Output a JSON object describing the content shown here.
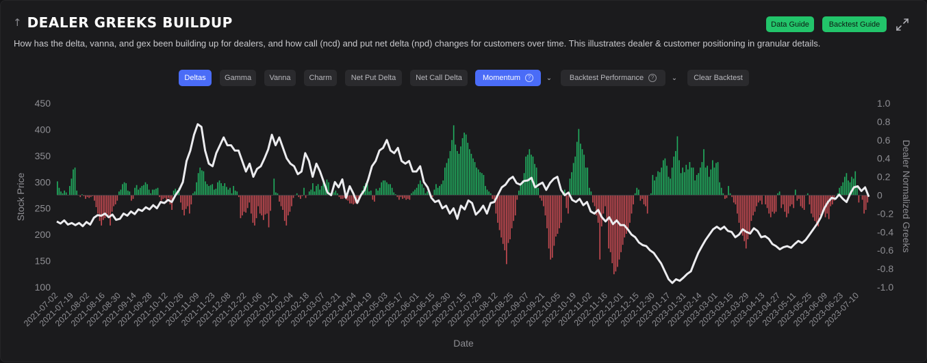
{
  "header": {
    "title": "DEALER GREEKS BUILDUP",
    "subtitle": "How has the delta, vanna, and gex been building up for dealers, and how call (ncd) and put net delta (npd) changes for customers over time. This illustrates dealer & customer positioning in granular details.",
    "collapse_icon": "arrow-up-icon",
    "expand_icon": "expand-icon",
    "buttons": {
      "data_guide": "Data Guide",
      "backtest_guide": "Backtest Guide"
    }
  },
  "toolbar": {
    "tabs": [
      {
        "label": "Deltas",
        "active": true
      },
      {
        "label": "Gamma",
        "active": false
      },
      {
        "label": "Vanna",
        "active": false
      },
      {
        "label": "Charm",
        "active": false
      },
      {
        "label": "Net Put Delta",
        "active": false
      },
      {
        "label": "Net Call Delta",
        "active": false
      }
    ],
    "momentum": {
      "label": "Momentum",
      "active": true
    },
    "backtest_performance": {
      "label": "Backtest Performance"
    },
    "clear_backtest": {
      "label": "Clear Backtest"
    }
  },
  "colors": {
    "positive": "#22c46a",
    "negative": "#e0525a",
    "price_line": "#ececef",
    "accent": "#4a6cf7",
    "axis_text": "#8e8e93"
  },
  "chart_data": {
    "type": "bar",
    "title": "",
    "xlabel": "Date",
    "ylabel": "Stock Price",
    "y2label": "Dealer Normalized Greeks",
    "ylim": [
      100,
      450
    ],
    "y2lim": [
      -1.0,
      1.0
    ],
    "yticks": [
      "450",
      "400",
      "350",
      "300",
      "250",
      "200",
      "150",
      "100"
    ],
    "y2ticks": [
      "1.0",
      "0.8",
      "0.6",
      "0.4",
      "0.2",
      "0",
      "-0.2",
      "-0.4",
      "-0.6",
      "-0.8",
      "-1.0"
    ],
    "grid": false,
    "legend": "none",
    "x_tick_labels": [
      "2021-07-02",
      "2021-07-19",
      "2021-08-02",
      "2021-08-16",
      "2021-08-30",
      "2021-09-14",
      "2021-09-28",
      "2021-10-12",
      "2021-10-26",
      "2021-11-09",
      "2021-11-23",
      "2021-12-08",
      "2021-12-22",
      "2022-01-06",
      "2022-01-21",
      "2022-02-04",
      "2022-02-18",
      "2022-03-07",
      "2022-03-21",
      "2022-04-04",
      "2022-04-19",
      "2022-05-03",
      "2022-05-17",
      "2022-06-01",
      "2022-06-15",
      "2022-06-30",
      "2022-07-15",
      "2022-07-29",
      "2022-08-12",
      "2022-08-25",
      "2022-09-07",
      "2022-09-21",
      "2022-10-05",
      "2022-10-19",
      "2022-11-02",
      "2022-11-16",
      "2022-12-01",
      "2022-12-15",
      "2022-12-30",
      "2023-01-17",
      "2023-01-31",
      "2023-02-14",
      "2023-03-01",
      "2023-03-15",
      "2023-03-29",
      "2023-04-13",
      "2023-04-27",
      "2023-05-11",
      "2023-05-25",
      "2023-06-09",
      "2023-06-23",
      "2023-07-10"
    ],
    "series": [
      {
        "name": "Stock Price",
        "type": "line",
        "values": [
          225,
          221,
          227,
          219,
          222,
          218,
          222,
          216,
          224,
          219,
          232,
          237,
          236,
          240,
          233,
          238,
          228,
          230,
          240,
          236,
          244,
          239,
          248,
          245,
          252,
          248,
          256,
          250,
          262,
          260,
          266,
          262,
          275,
          285,
          300,
          340,
          360,
          390,
          410,
          405,
          360,
          335,
          330,
          355,
          370,
          385,
          370,
          370,
          360,
          360,
          340,
          320,
          335,
          310,
          325,
          330,
          345,
          362,
          390,
          370,
          385,
          365,
          345,
          335,
          330,
          315,
          320,
          355,
          340,
          310,
          335,
          320,
          300,
          280,
          275,
          300,
          290,
          305,
          270,
          292,
          278,
          260,
          275,
          285,
          305,
          330,
          340,
          360,
          365,
          380,
          360,
          355,
          365,
          340,
          335,
          340,
          320,
          320,
          330,
          300,
          290,
          270,
          262,
          265,
          250,
          255,
          240,
          250,
          230,
          255,
          248,
          265,
          260,
          238,
          245,
          255,
          240,
          260,
          262,
          276,
          290,
          295,
          305,
          310,
          298,
          295,
          302,
          303,
          308,
          290,
          295,
          299,
          285,
          298,
          306,
          310,
          285,
          275,
          280,
          266,
          262,
          268,
          256,
          262,
          244,
          240,
          247,
          233,
          225,
          233,
          220,
          227,
          218,
          218,
          210,
          200,
          195,
          185,
          180,
          178,
          170,
          165,
          155,
          145,
          130,
          115,
          108,
          115,
          112,
          118,
          125,
          130,
          148,
          165,
          178,
          190,
          200,
          210,
          215,
          210,
          215,
          207,
          205,
          195,
          200,
          210,
          205,
          202,
          212,
          207,
          195,
          197,
          192,
          182,
          178,
          172,
          176,
          178,
          175,
          182,
          188,
          184,
          190,
          200,
          210,
          220,
          232,
          250,
          262,
          270,
          268,
          276,
          268,
          262,
          278,
          290,
          292,
          283,
          290,
          272
        ],
        "y_axis": "left"
      },
      {
        "name": "Dealer Normalized Greeks (Momentum)",
        "type": "bar",
        "values": [
          0.15,
          0.08,
          0.04,
          0.02,
          0.05,
          0.03,
          0.0,
          0.1,
          0.18,
          0.28,
          0.3,
          0.05,
          0.0,
          -0.02,
          0.01,
          -0.01,
          -0.04,
          -0.02,
          -0.03,
          -0.02,
          -0.01,
          -0.06,
          -0.13,
          -0.2,
          -0.28,
          -0.33,
          -0.27,
          -0.25,
          -0.2,
          -0.22,
          -0.33,
          -0.18,
          -0.12,
          -0.1,
          -0.06,
          0.04,
          0.06,
          0.12,
          0.14,
          0.13,
          0.05,
          0.04,
          -0.06,
          -0.04,
          0.08,
          0.11,
          0.06,
          0.08,
          0.1,
          0.11,
          0.14,
          0.12,
          0.06,
          0.02,
          0.06,
          0.06,
          0.07,
          0.08,
          -0.02,
          -0.06,
          -0.04,
          -0.03,
          -0.08,
          -0.03,
          -0.1,
          -0.16,
          0.05,
          0.07,
          0.05,
          0.08,
          -0.08,
          -0.16,
          -0.22,
          -0.15,
          -0.12,
          -0.2,
          -0.1,
          0.02,
          0.04,
          0.14,
          0.24,
          0.3,
          0.27,
          0.26,
          0.15,
          0.12,
          0.1,
          0.11,
          0.12,
          0.06,
          0.07,
          0.14,
          0.16,
          0.13,
          0.1,
          0.13,
          0.09,
          0.06,
          0.08,
          0.02,
          0.1,
          0.05,
          0.04,
          -0.02,
          -0.25,
          -0.22,
          -0.18,
          -0.19,
          -0.14,
          -0.08,
          -0.2,
          -0.3,
          -0.33,
          -0.25,
          -0.12,
          -0.2,
          -0.22,
          -0.27,
          -0.21,
          -0.2,
          -0.35,
          -0.17,
          0.0,
          0.18,
          0.03,
          0.02,
          -0.07,
          -0.12,
          -0.16,
          -0.28,
          -0.33,
          -0.22,
          -0.18,
          -0.12,
          -0.03,
          0.0,
          0.02,
          -0.02,
          -0.04,
          -0.01,
          0.08,
          -0.03,
          0.0,
          0.04,
          0.06,
          0.13,
          0.04,
          0.1,
          0.12,
          0.06,
          0.1,
          0.15,
          0.11,
          0.17,
          0.14,
          0.0,
          0.02,
          0.03,
          0.05,
          0.02,
          -0.02,
          -0.04,
          -0.04,
          -0.03,
          -0.05,
          -0.06,
          -0.09,
          -0.09,
          -0.1,
          -0.09,
          -0.06,
          -0.08,
          0.0,
          0.05,
          0.1,
          0.13,
          0.12,
          0.04,
          0.05,
          -0.05,
          -0.07,
          0.07,
          0.05,
          0.08,
          0.14,
          0.16,
          0.16,
          0.14,
          0.12,
          0.12,
          0.08,
          0.03,
          0.01,
          -0.02,
          -0.05,
          -0.02,
          -0.04,
          -0.03,
          -0.05,
          -0.04,
          -0.05,
          0.02,
          0.04,
          0.06,
          0.08,
          0.12,
          0.16,
          0.12,
          0.08,
          0.02,
          0.04,
          0.03,
          -0.01,
          -0.02,
          0.06,
          0.12,
          0.08,
          0.1,
          0.12,
          0.16,
          0.3,
          0.35,
          0.4,
          0.48,
          0.6,
          0.76,
          0.55,
          0.48,
          0.45,
          0.53,
          0.62,
          0.68,
          0.66,
          0.57,
          0.5,
          0.45,
          0.4,
          0.36,
          0.3,
          0.28,
          0.25,
          0.24,
          0.22,
          0.1,
          0.06,
          0.04,
          0.02,
          -0.04,
          -0.05,
          -0.2,
          -0.3,
          -0.38,
          -0.46,
          -0.53,
          -0.6,
          -0.75,
          -0.52,
          -0.48,
          -0.36,
          -0.28,
          -0.22,
          -0.05,
          0.05,
          0.12,
          0.16,
          0.24,
          0.42,
          0.44,
          0.5,
          0.44,
          0.42,
          0.34,
          0.3,
          0.08,
          -0.03,
          -0.06,
          -0.12,
          -0.22,
          -0.36,
          -0.58,
          -0.7,
          -0.68,
          -0.55,
          -0.45,
          -0.42,
          -0.36,
          -0.3,
          0.04,
          0.06,
          -0.14,
          -0.2,
          0.18,
          0.25,
          0.35,
          0.42,
          0.58,
          0.72,
          0.56,
          0.5,
          0.44,
          0.3,
          0.3,
          0.08,
          0.04,
          -0.08,
          -0.12,
          -0.22,
          -0.3,
          -0.7,
          -0.34,
          -0.2,
          -0.12,
          -0.26,
          -0.58,
          -0.62,
          -0.74,
          -0.86,
          -0.83,
          -0.78,
          -0.7,
          -0.62,
          -0.54,
          -0.46,
          -0.42,
          -0.36,
          -0.3,
          -0.2,
          -0.1,
          0.02,
          0.08,
          0.06,
          -0.06,
          -0.04,
          -0.1,
          -0.12,
          -0.2,
          0.0,
          0.02,
          0.22,
          0.16,
          0.2,
          0.26,
          0.25,
          0.3,
          0.38,
          0.4,
          0.32,
          0.2,
          0.18,
          0.3,
          0.42,
          0.48,
          0.64,
          0.38,
          0.24,
          0.3,
          0.25,
          0.33,
          0.28,
          0.36,
          0.3,
          0.3,
          0.16,
          0.22,
          0.24,
          0.3,
          0.36,
          0.5,
          0.3,
          0.32,
          0.2,
          0.28,
          0.38,
          0.3,
          0.35,
          0.36,
          0.14,
          0.08,
          0.02,
          -0.04,
          -0.03,
          0.1,
          0.02,
          -0.02,
          -0.08,
          -0.1,
          -0.2,
          -0.3,
          -0.4,
          -0.44,
          -0.5,
          -0.58,
          -0.48,
          -0.4,
          -0.28,
          -0.22,
          -0.18,
          -0.12,
          -0.08,
          -0.06,
          -0.1,
          0.0,
          -0.1,
          -0.14,
          -0.2,
          -0.24,
          -0.18,
          -0.2,
          -0.18,
          0.02,
          0.04,
          -0.14,
          -0.1,
          -0.18,
          -0.24,
          -0.2,
          -0.12,
          -0.1,
          -0.14,
          0.06,
          -0.06,
          -0.04,
          -0.12,
          -0.14,
          -0.16,
          0.0,
          0.02,
          -0.1,
          -0.2,
          -0.24,
          -0.28,
          -0.3,
          -0.34,
          -0.22,
          -0.2,
          -0.18,
          -0.24,
          -0.2,
          -0.26,
          -0.12,
          -0.1,
          -0.06,
          0.0,
          0.02,
          0.08,
          0.1,
          0.14,
          0.2,
          0.24,
          0.16,
          0.14,
          0.2,
          0.18,
          0.26,
          0.1,
          -0.08,
          0.0,
          -0.05,
          -0.2,
          -0.16,
          -0.08
        ],
        "y_axis": "right"
      }
    ]
  }
}
